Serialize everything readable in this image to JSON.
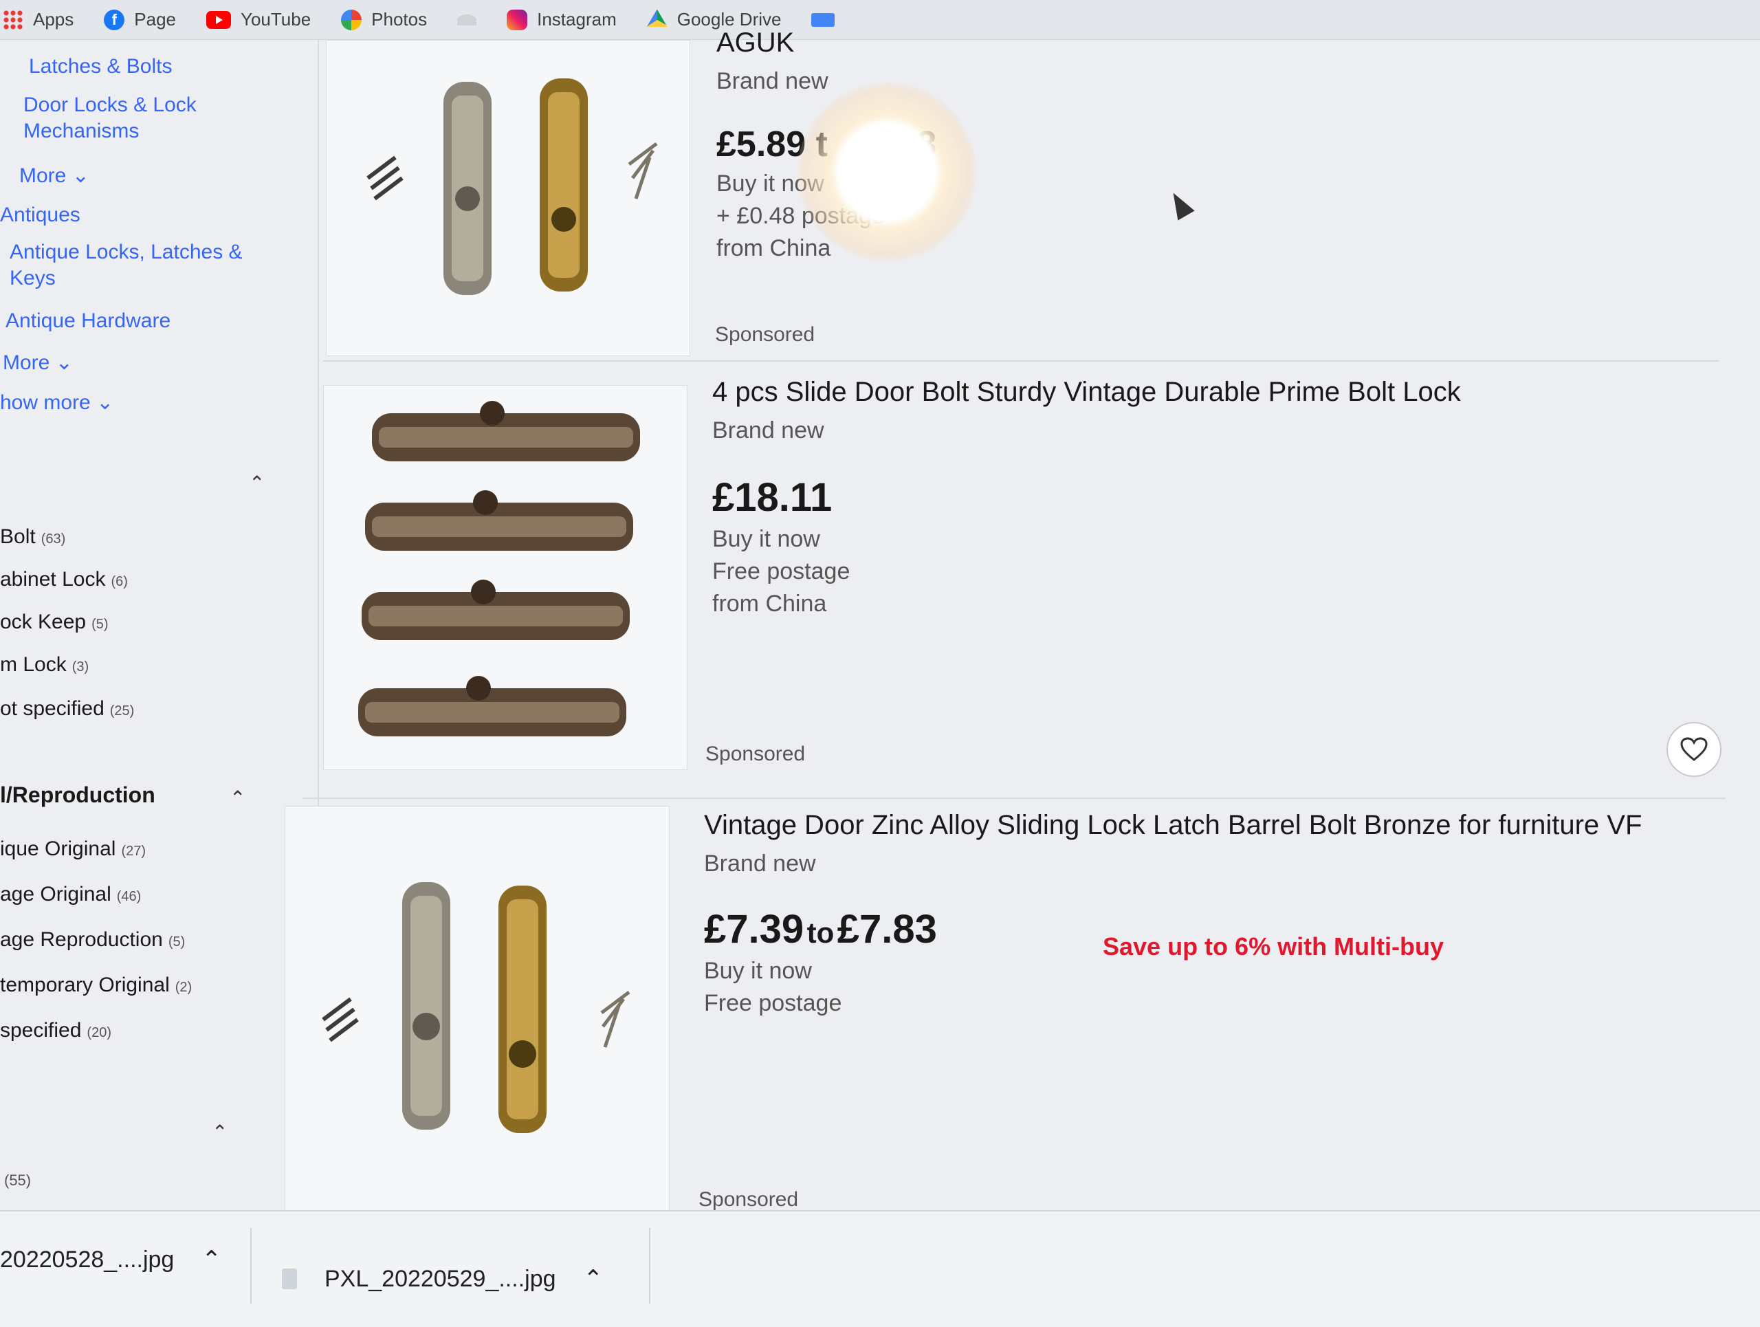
{
  "bookmarks": [
    "Apps",
    "Page",
    "YouTube",
    "Photos",
    "Instagram",
    "Google Drive"
  ],
  "sidebar": {
    "links_top": [
      "Latches & Bolts",
      "Door Locks & Lock Mechanisms",
      "More"
    ],
    "antiques": "Antiques",
    "links_antiques": [
      "Antique Locks, Latches & Keys",
      "Antique Hardware",
      "More"
    ],
    "show_more": "how more",
    "type_items": [
      {
        "label": "Bolt",
        "count": "(63)"
      },
      {
        "label": "abinet Lock",
        "count": "(6)"
      },
      {
        "label": "ock Keep",
        "count": "(5)"
      },
      {
        "label": "m Lock",
        "count": "(3)"
      },
      {
        "label": "ot specified",
        "count": "(25)"
      }
    ],
    "section_head": "l/Reproduction",
    "repro_items": [
      {
        "label": "ique Original",
        "count": "(27)"
      },
      {
        "label": "age Original",
        "count": "(46)"
      },
      {
        "label": "age Reproduction",
        "count": "(5)"
      },
      {
        "label": "temporary Original",
        "count": "(2)"
      },
      {
        "label": "specified",
        "count": "(20)"
      }
    ],
    "bottom_count": "(55)"
  },
  "listings": [
    {
      "title": "AGUK",
      "condition": "Brand new",
      "price": "£5.89 t",
      "price_end": "28",
      "buy": "Buy it now",
      "postage": "+ £0.48 postage",
      "origin": "from China",
      "sponsored": "Sponsored"
    },
    {
      "title": "4 pcs Slide Door Bolt Sturdy Vintage Durable Prime Bolt Lock",
      "condition": "Brand new",
      "price": "£18.11",
      "buy": "Buy it now",
      "postage": "Free postage",
      "origin": "from China",
      "sponsored": "Sponsored"
    },
    {
      "title": "Vintage Door Zinc Alloy Sliding Lock Latch Barrel Bolt Bronze for furniture VF",
      "condition": "Brand new",
      "price_from": "£7.39",
      "price_to_word": "to",
      "price_to": "£7.83",
      "promo": "Save up to 6% with Multi-buy",
      "buy": "Buy it now",
      "postage": "Free postage",
      "sponsored": "Sponsored"
    }
  ],
  "downloads": [
    {
      "name": "20220528_....jpg"
    },
    {
      "name": "PXL_20220529_....jpg"
    }
  ],
  "colors": {
    "link": "#3665f3",
    "promo": "#e0182d",
    "text": "#191919"
  }
}
